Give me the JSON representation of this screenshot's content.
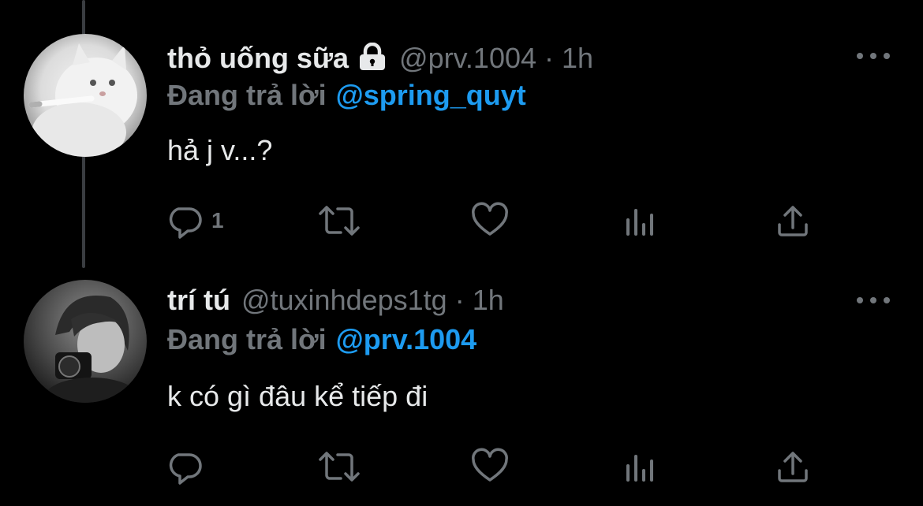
{
  "tweets": [
    {
      "display_name": "thỏ uống sữa",
      "protected": true,
      "handle": "@prv.1004",
      "separator": "·",
      "time": "1h",
      "reply_prefix": "Đang trả lời",
      "reply_to": "@spring_quyt",
      "text": "hả j v...?",
      "reply_count": "1",
      "avatar": "white-cat-with-cigarette"
    },
    {
      "display_name": "trí tú",
      "protected": false,
      "handle": "@tuxinhdeps1tg",
      "separator": "·",
      "time": "1h",
      "reply_prefix": "Đang trả lời",
      "reply_to": "@prv.1004",
      "text": "k có gì đâu kể tiếp đi",
      "reply_count": "",
      "avatar": "person-with-camera-monochrome"
    }
  ],
  "icons": {
    "more": "more-horizontal-icon",
    "reply": "speech-bubble-icon",
    "retweet": "retweet-arrows-icon",
    "like": "heart-outline-icon",
    "views": "bar-chart-icon",
    "share": "share-upload-icon",
    "lock": "lock-icon"
  },
  "colors": {
    "background": "#000000",
    "primary_text": "#e7e9ea",
    "secondary_text": "#71767b",
    "accent": "#1d9bf0",
    "thread_line": "#3a3d41"
  }
}
